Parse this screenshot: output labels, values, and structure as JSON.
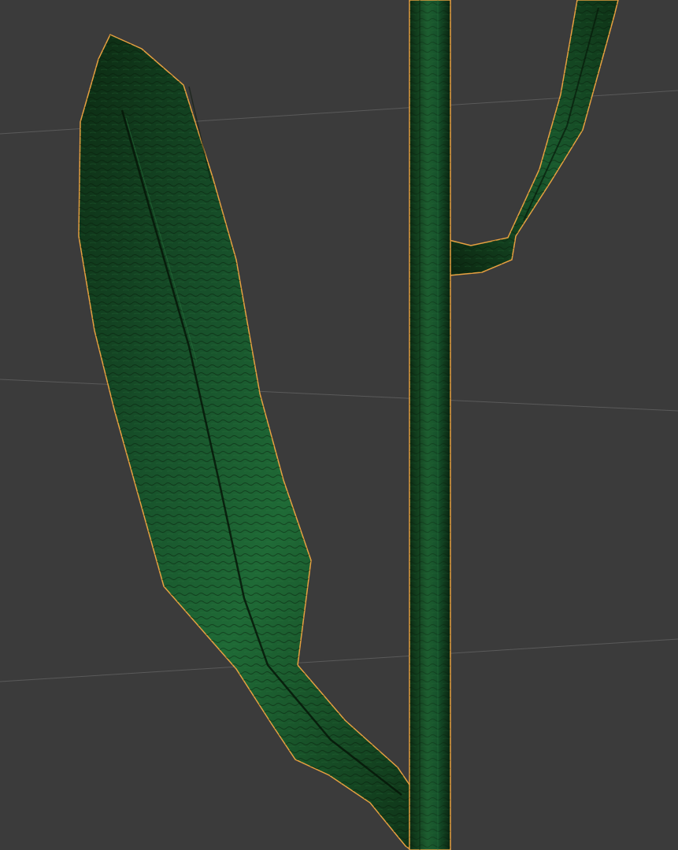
{
  "viewport": {
    "background_color": "#3b3b3b",
    "grid_line_color": "#5a5a5a",
    "selection_outline_color": "#e8a040",
    "mesh_colors": {
      "dark": "#0c2a12",
      "mid": "#14502a",
      "light": "#1f6a36"
    }
  },
  "scene": {
    "objects": [
      "plant-stem",
      "lower-leaf",
      "upper-leaf"
    ]
  }
}
